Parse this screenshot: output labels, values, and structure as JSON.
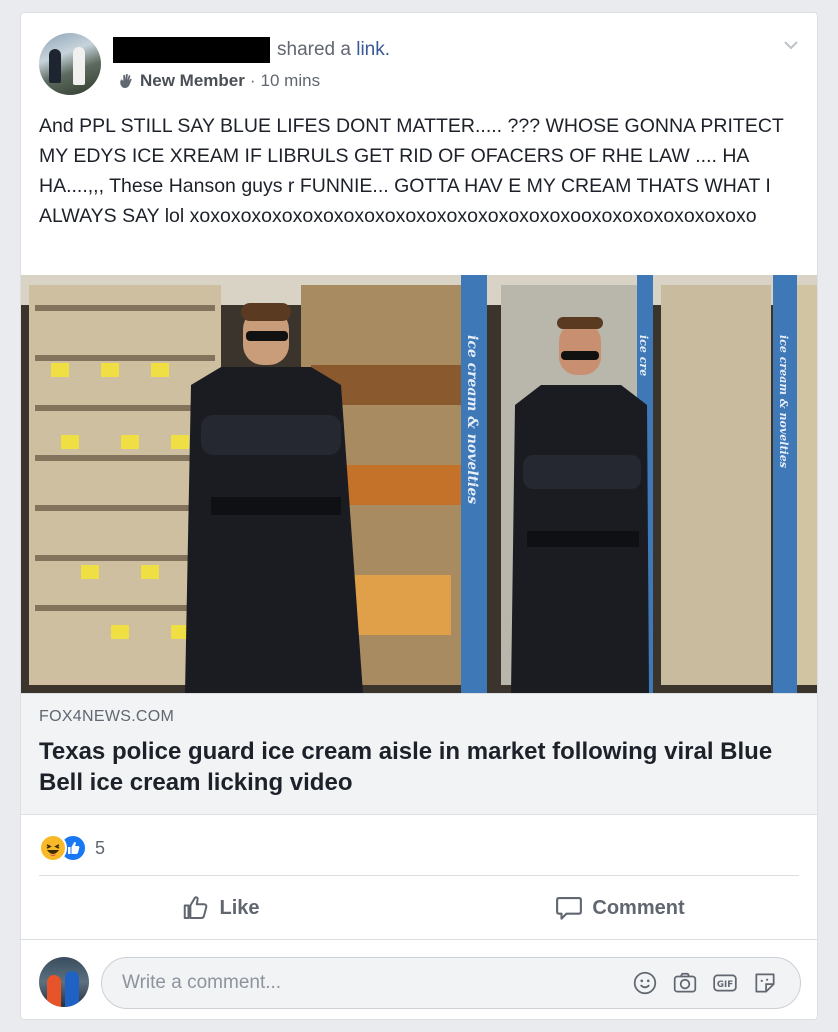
{
  "post": {
    "shared_prefix": "shared a",
    "shared_link": "link.",
    "badge": "New Member",
    "time_separator": "·",
    "time": "10 mins",
    "text": "And PPL STILL SAY BLUE LIFES DONT MATTER..... ??? WHOSE GONNA PRITECT MY EDYS ICE XREAM IF LIBRULS GET RID OF OFACERS OF RHE LAW .... HA HA....,,, These Hanson guys r FUNNIE... GOTTA HAV E MY CREAM THATS WHAT I ALWAYS SAY lol xoxoxoxoxoxoxoxoxoxoxoxoxoxoxoxoxoxoxooxoxoxoxoxoxoxoxo"
  },
  "photo": {
    "freezer_sign_1": "ice cream & novelties",
    "freezer_sign_2": "ice cre",
    "freezer_sign_3": "ice cream & novelties"
  },
  "link": {
    "domain": "FOX4NEWS.COM",
    "headline": "Texas police guard ice cream aisle in market following viral Blue Bell ice cream licking video"
  },
  "reactions": {
    "count": "5"
  },
  "actions": {
    "like": "Like",
    "comment": "Comment"
  },
  "comment_box": {
    "placeholder": "Write a comment..."
  },
  "colors": {
    "link": "#385898",
    "like_blue": "#1877f2",
    "haha_yellow": "#f7b928"
  }
}
